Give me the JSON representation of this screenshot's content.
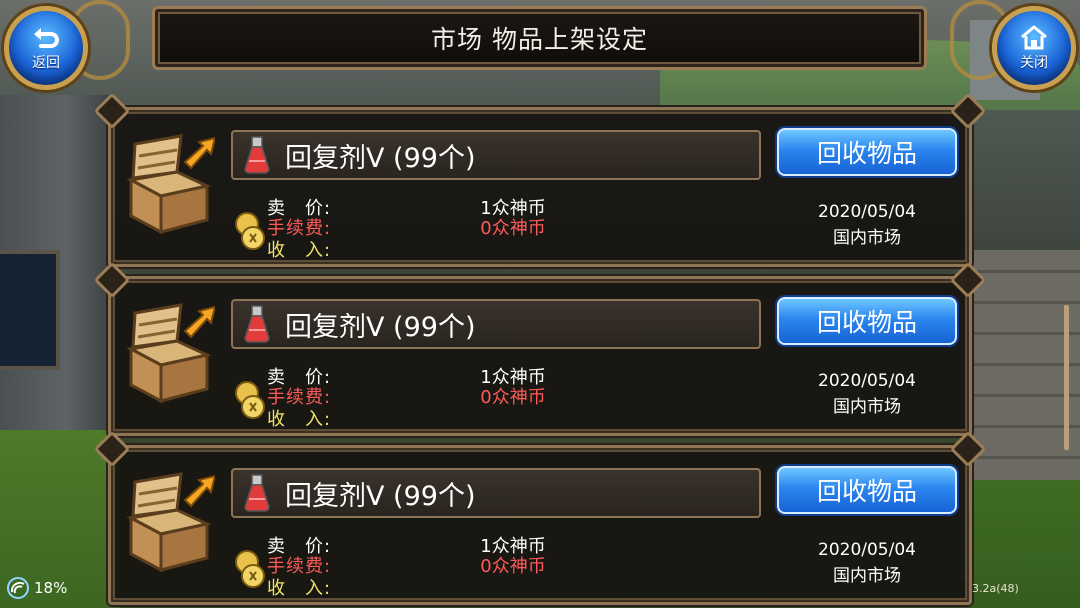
{
  "header": {
    "title": "市场 物品上架设定",
    "back_label": "返回",
    "close_label": "关闭"
  },
  "listings": [
    {
      "item_name": "回复剂Ⅴ (99个)",
      "retrieve_label": "回收物品",
      "price_label": "卖　价:",
      "fee_label": "手续费:",
      "income_label": "收　入:",
      "price_value": "1众神币",
      "fee_value": "0众神币",
      "date": "2020/05/04",
      "market": "国内市场"
    },
    {
      "item_name": "回复剂Ⅴ (99个)",
      "retrieve_label": "回收物品",
      "price_label": "卖　价:",
      "fee_label": "手续费:",
      "income_label": "收　入:",
      "price_value": "1众神币",
      "fee_value": "0众神币",
      "date": "2020/05/04",
      "market": "国内市场"
    },
    {
      "item_name": "回复剂Ⅴ (99个)",
      "retrieve_label": "回收物品",
      "price_label": "卖　价:",
      "fee_label": "手续费:",
      "income_label": "收　入:",
      "price_value": "1众神币",
      "fee_value": "0众神币",
      "date": "2020/05/04",
      "market": "国内市场"
    }
  ],
  "status": {
    "battery": "18%",
    "version": "3.2a(48)"
  },
  "icons": {
    "back": "back-arrow-icon",
    "close": "home-icon",
    "chest": "treasure-chest-icon",
    "potion": "potion-icon",
    "coins": "coins-icon",
    "signal": "signal-icon"
  },
  "colors": {
    "button_blue": "#2b86ef",
    "fee_red": "#ff5a5a",
    "income_yellow": "#f0e26a",
    "frame_gold": "#8d7555"
  }
}
